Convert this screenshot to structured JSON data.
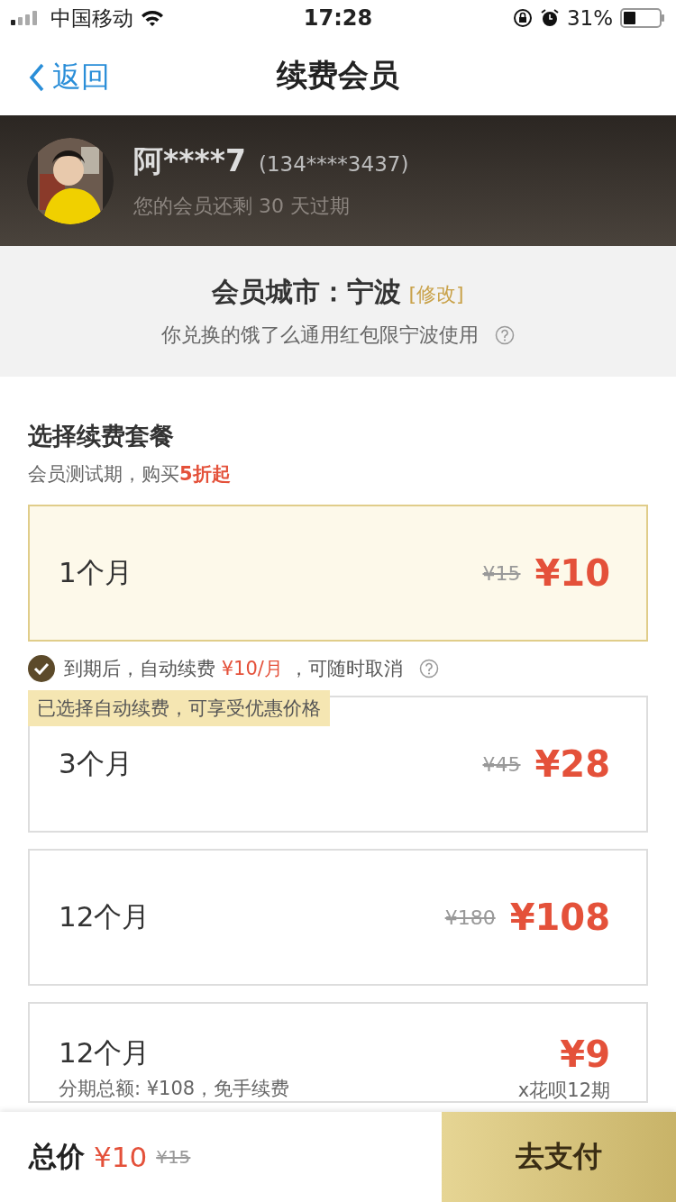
{
  "status_bar": {
    "carrier": "中国移动",
    "time": "17:28",
    "battery": "31%"
  },
  "nav": {
    "back": "返回",
    "title": "续费会员"
  },
  "user": {
    "name": "阿****7",
    "phone": "(134****3437)",
    "expiry": "您的会员还剩 30 天过期"
  },
  "city": {
    "label": "会员城市：",
    "name": "宁波",
    "edit": "[修改]",
    "note": "你兑换的饿了么通用红包限宁波使用"
  },
  "section": {
    "title": "选择续费套餐",
    "subtitle": "会员测试期，购买**5折起**"
  },
  "plans": [
    {
      "kind": "simple",
      "name": "1个月",
      "old_price": "¥15",
      "price": "¥10",
      "selected": true
    },
    {
      "kind": "simple",
      "name": "3个月",
      "old_price": "¥45",
      "price": "¥28",
      "selected": false
    },
    {
      "kind": "simple",
      "name": "12个月",
      "old_price": "¥180",
      "price": "¥108",
      "selected": false
    },
    {
      "kind": "installment",
      "name": "12个月",
      "detail": "分期总额: ¥108，免手续费",
      "price": "¥9",
      "price_note": "x花呗12期",
      "selected": false
    }
  ],
  "auto_renew": {
    "checked": true,
    "before": "到期后，自动续费",
    "amount": "¥10/月",
    "after": "，可随时取消",
    "tip": "已选择自动续费，可享受优惠价格"
  },
  "footer": {
    "label": "总价",
    "price": "¥10",
    "old_price": "¥15",
    "pay": "去支付"
  }
}
